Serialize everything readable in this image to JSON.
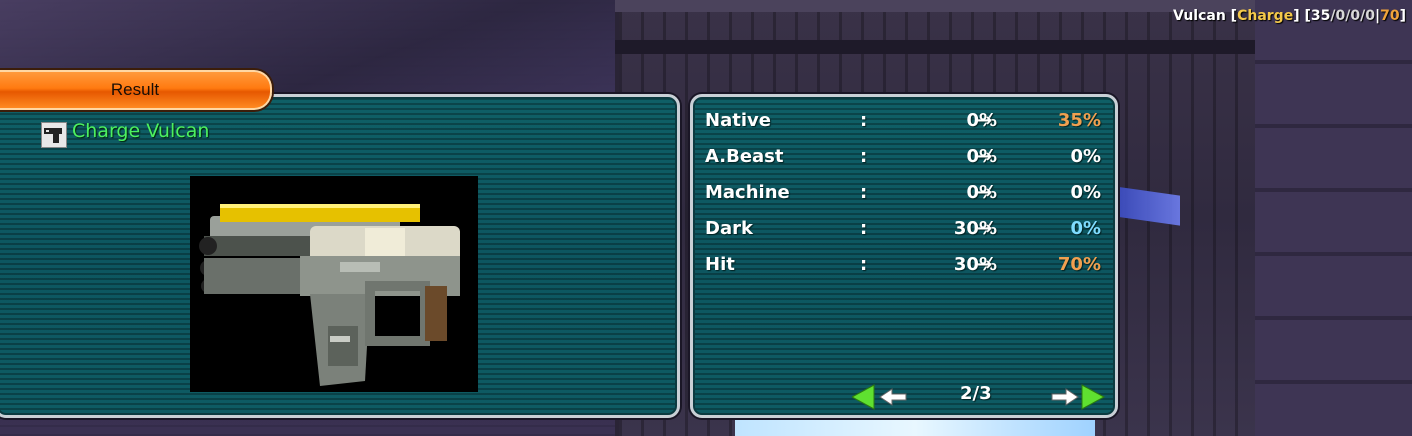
{
  "status": {
    "weapon": "Vulcan",
    "grind": "Charge",
    "stats": [
      "35",
      "0",
      "0",
      "0"
    ],
    "hit": "70"
  },
  "result_tab": {
    "label": "Result"
  },
  "item": {
    "name": "Charge Vulcan",
    "icon": "handgun-icon"
  },
  "stats": [
    {
      "label": "Native",
      "from": "0%",
      "to": "35%",
      "to_color": "orange"
    },
    {
      "label": "A.Beast",
      "from": "0%",
      "to": "0%",
      "to_color": "white"
    },
    {
      "label": "Machine",
      "from": "0%",
      "to": "0%",
      "to_color": "white"
    },
    {
      "label": "Dark",
      "from": "30%",
      "to": "0%",
      "to_color": "cyan"
    },
    {
      "label": "Hit",
      "from": "30%",
      "to": "70%",
      "to_color": "orange"
    }
  ],
  "colon": ":",
  "arrow": "→",
  "pager": {
    "current": "2/3"
  },
  "colors": {
    "green_accent": "#4cf060",
    "orange": "#f0a050",
    "cyan": "#7fdcff",
    "tab_orange": "#ff7a10",
    "panel_teal": "#0e5b63"
  }
}
